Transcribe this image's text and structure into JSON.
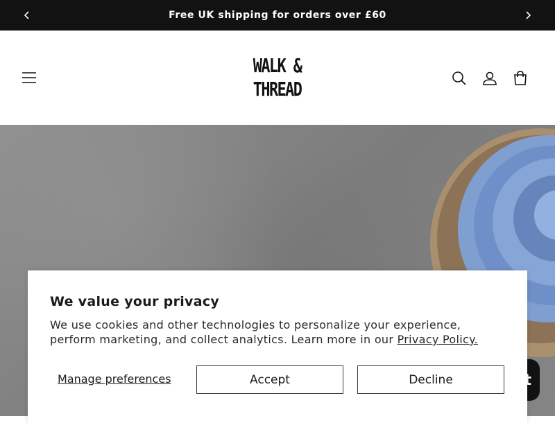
{
  "announcement": {
    "text": "Free UK shipping for orders over £60",
    "prev_icon": "chevron-left-icon",
    "next_icon": "chevron-right-icon"
  },
  "header": {
    "logo_line1": "WALK & ",
    "logo_line2": "THREAD",
    "icons": [
      "menu-icon",
      "search-icon",
      "account-icon",
      "cart-icon"
    ]
  },
  "chat_badge": {
    "text": "t"
  },
  "cookie_banner": {
    "title": "We value your privacy",
    "body": "We use cookies and other technologies to personalize your experience, perform marketing, and collect analytics. Learn more in our ",
    "link_text": "Privacy Policy.",
    "manage_label": "Manage preferences",
    "accept_label": "Accept",
    "decline_label": "Decline"
  }
}
